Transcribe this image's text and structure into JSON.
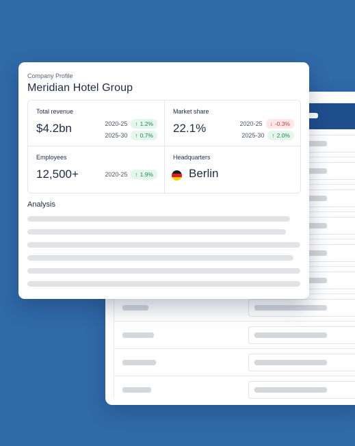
{
  "colors": {
    "background": "#2f6aa9",
    "table_header": "#1f4e8c",
    "positive": "#1f8a4c",
    "negative": "#d23c3c"
  },
  "profile": {
    "eyebrow": "Company Profile",
    "company_name": "Meridian Hotel Group",
    "stats": {
      "total_revenue": {
        "label": "Total revenue",
        "value": "$4.2bn",
        "changes": [
          {
            "period": "2020-25",
            "delta": "1.2%",
            "direction": "up"
          },
          {
            "period": "2025-30",
            "delta": "0.7%",
            "direction": "up"
          }
        ]
      },
      "market_share": {
        "label": "Market share",
        "value": "22.1%",
        "changes": [
          {
            "period": "2020-25",
            "delta": "-0.3%",
            "direction": "down"
          },
          {
            "period": "2025-30",
            "delta": "2.0%",
            "direction": "up"
          }
        ]
      },
      "employees": {
        "label": "Employees",
        "value": "12,500+",
        "changes": [
          {
            "period": "2020-25",
            "delta": "1.9%",
            "direction": "up"
          }
        ]
      },
      "headquarters": {
        "label": "Headquarters",
        "value": "Berlin",
        "flag_icon": "germany-flag-icon"
      }
    },
    "analysis_heading": "Analysis"
  },
  "icons": {
    "up": "arrow-up-icon",
    "down": "arrow-down-icon"
  }
}
